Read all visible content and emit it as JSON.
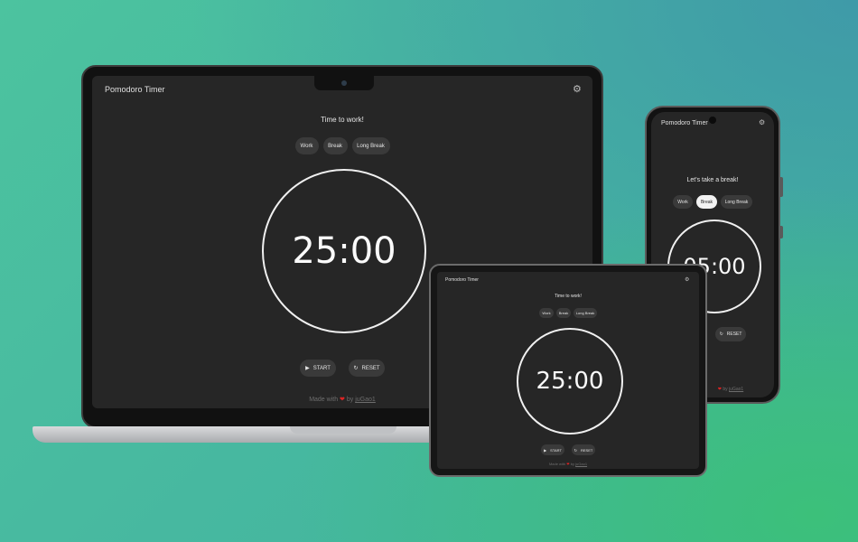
{
  "colors": {
    "screen_bg": "#262626",
    "button_bg": "#3a3a3a",
    "heart": "#e02424",
    "background": "#46bd9d"
  },
  "laptop": {
    "app_title": "Pomodoro Timer",
    "status": "Time to work!",
    "modes": [
      "Work",
      "Break",
      "Long Break"
    ],
    "time": "25:00",
    "start_label": "START",
    "reset_label": "RESET",
    "footer_prefix": "Made with",
    "footer_by": "by",
    "footer_author": "juGao1"
  },
  "tablet": {
    "app_title": "Pomodoro Timer",
    "status": "Time to work!",
    "modes": [
      "Work",
      "Break",
      "Long Break"
    ],
    "time": "25:00",
    "start_label": "START",
    "reset_label": "RESET",
    "footer_prefix": "Made with",
    "footer_by": "by",
    "footer_author": "juGao1"
  },
  "phone": {
    "app_title": "Pomodoro Timer",
    "status": "Let's take a break!",
    "modes": [
      "Work",
      "Break",
      "Long Break"
    ],
    "active_mode": "Break",
    "time": "05:00",
    "reset_label": "RESET",
    "footer_by": "by",
    "footer_author": "juGao1"
  },
  "icons": {
    "settings": "gear-icon",
    "start": "play-icon",
    "reset": "refresh-icon",
    "heart": "heart-icon"
  }
}
